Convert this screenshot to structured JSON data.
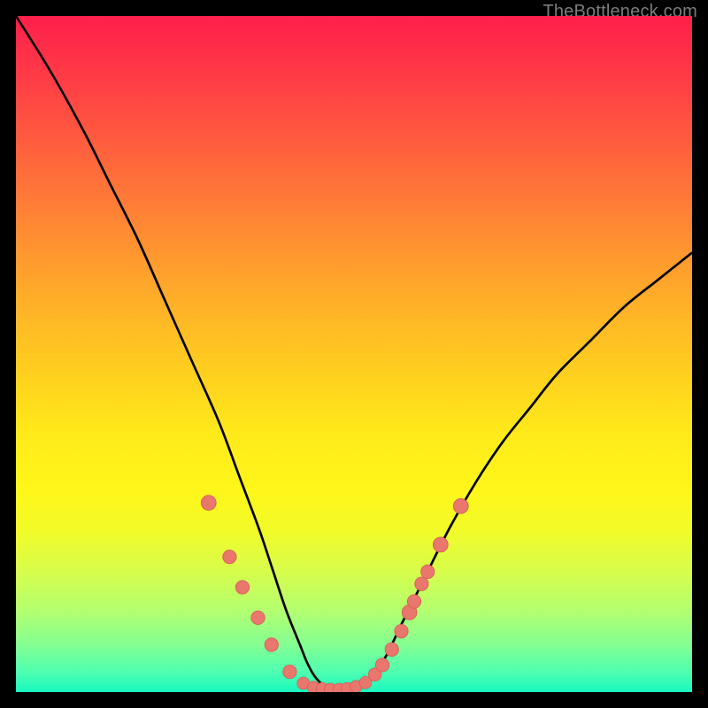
{
  "watermark": "TheBottleneck.com",
  "colors": {
    "curve": "#000000",
    "marker_fill": "#e9776e",
    "marker_stroke": "#d85f56",
    "gradient_top": "#ff1f4b",
    "gradient_bottom": "#18f7c0"
  },
  "chart_data": {
    "type": "line",
    "title": "",
    "xlabel": "",
    "ylabel": "",
    "xlim": [
      0,
      100
    ],
    "ylim": [
      0,
      100
    ],
    "series": [
      {
        "name": "bottleneck-curve",
        "x": [
          0,
          5,
          10,
          14,
          18,
          22,
          26,
          30,
          33,
          36,
          38,
          40,
          42,
          43,
          44,
          45,
          46,
          47,
          48,
          49,
          50,
          51,
          52,
          53,
          55,
          57,
          60,
          64,
          68,
          72,
          76,
          80,
          85,
          90,
          95,
          100
        ],
        "y": [
          100,
          92,
          83,
          75,
          67,
          58,
          49,
          40,
          32,
          24,
          18,
          12,
          7,
          4.5,
          2.6,
          1.4,
          0.7,
          0.3,
          0.2,
          0.2,
          0.3,
          0.6,
          1.3,
          2.5,
          5.8,
          10,
          16,
          24,
          31,
          37,
          42,
          47,
          52,
          57,
          61,
          65
        ]
      }
    ],
    "markers": [
      {
        "x": 28.5,
        "y": 28.0,
        "r": 1.1
      },
      {
        "x": 31.6,
        "y": 20.0,
        "r": 1.0
      },
      {
        "x": 33.5,
        "y": 15.5,
        "r": 1.0
      },
      {
        "x": 35.8,
        "y": 11.0,
        "r": 1.0
      },
      {
        "x": 37.8,
        "y": 7.0,
        "r": 1.0
      },
      {
        "x": 40.5,
        "y": 3.0,
        "r": 1.0
      },
      {
        "x": 42.5,
        "y": 1.3,
        "r": 0.9
      },
      {
        "x": 44.0,
        "y": 0.7,
        "r": 0.9
      },
      {
        "x": 45.3,
        "y": 0.5,
        "r": 0.9
      },
      {
        "x": 46.5,
        "y": 0.4,
        "r": 0.9
      },
      {
        "x": 47.8,
        "y": 0.4,
        "r": 0.9
      },
      {
        "x": 49.0,
        "y": 0.5,
        "r": 0.9
      },
      {
        "x": 50.3,
        "y": 0.8,
        "r": 0.9
      },
      {
        "x": 51.7,
        "y": 1.4,
        "r": 0.9
      },
      {
        "x": 53.1,
        "y": 2.6,
        "r": 0.95
      },
      {
        "x": 54.2,
        "y": 4.0,
        "r": 1.0
      },
      {
        "x": 55.6,
        "y": 6.3,
        "r": 1.0
      },
      {
        "x": 57.0,
        "y": 9.0,
        "r": 1.0
      },
      {
        "x": 58.2,
        "y": 11.8,
        "r": 1.1
      },
      {
        "x": 58.9,
        "y": 13.4,
        "r": 1.0
      },
      {
        "x": 60.0,
        "y": 16.0,
        "r": 1.0
      },
      {
        "x": 60.9,
        "y": 17.8,
        "r": 1.0
      },
      {
        "x": 62.8,
        "y": 21.8,
        "r": 1.1
      },
      {
        "x": 65.8,
        "y": 27.5,
        "r": 1.1
      }
    ],
    "annotations": []
  }
}
